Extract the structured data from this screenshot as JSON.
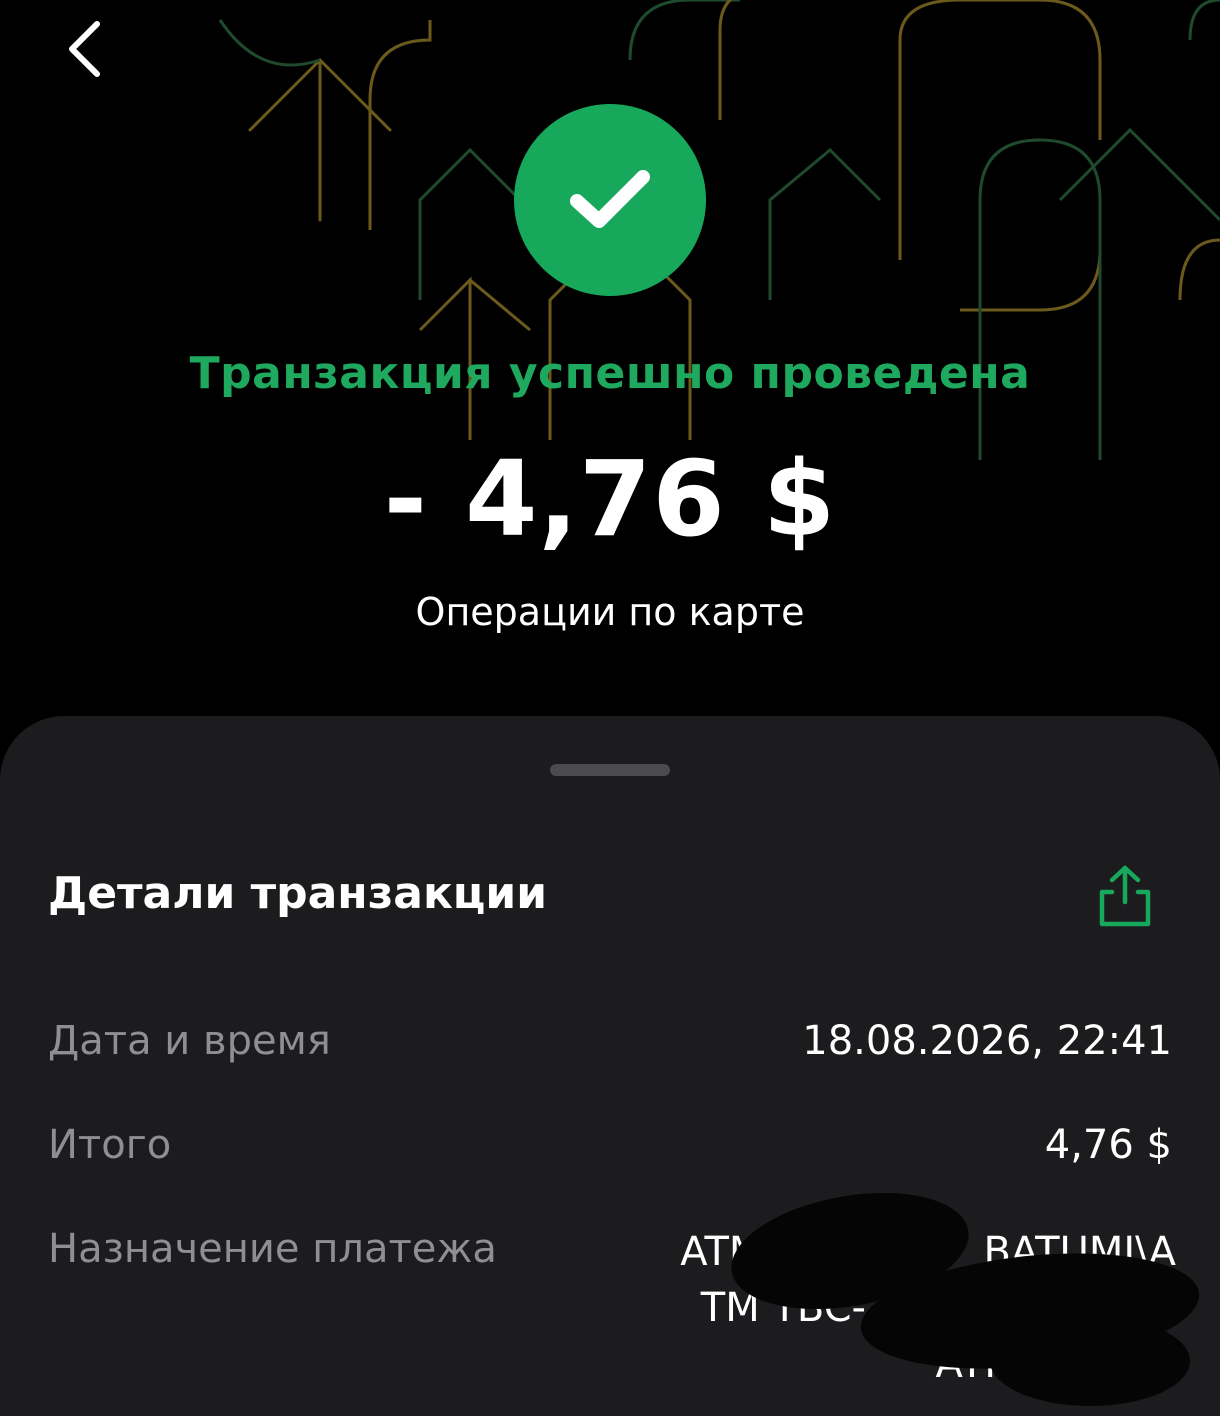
{
  "header": {
    "back_icon": "chevron-left-icon"
  },
  "status": {
    "icon": "checkmark-icon",
    "title": "Транзакция успешно проведена",
    "amount": "- 4,76 $",
    "operation_type": "Операции по карте"
  },
  "details": {
    "title": "Детали транзакции",
    "share_icon": "share-icon",
    "rows": [
      {
        "label": "Дата и время",
        "value": "18.08.2026, 22:41"
      },
      {
        "label": "Итого",
        "value": "4,76 $"
      },
      {
        "label": "Назначение платежа",
        "value_lines": [
          "ATM",
          "BATUMI\\A",
          "TM TBC-",
          "ATI"
        ]
      }
    ]
  },
  "colors": {
    "accent": "#17a85c",
    "background": "#000000",
    "sheet": "#1c1c1e",
    "muted_text": "#8e8e93"
  }
}
